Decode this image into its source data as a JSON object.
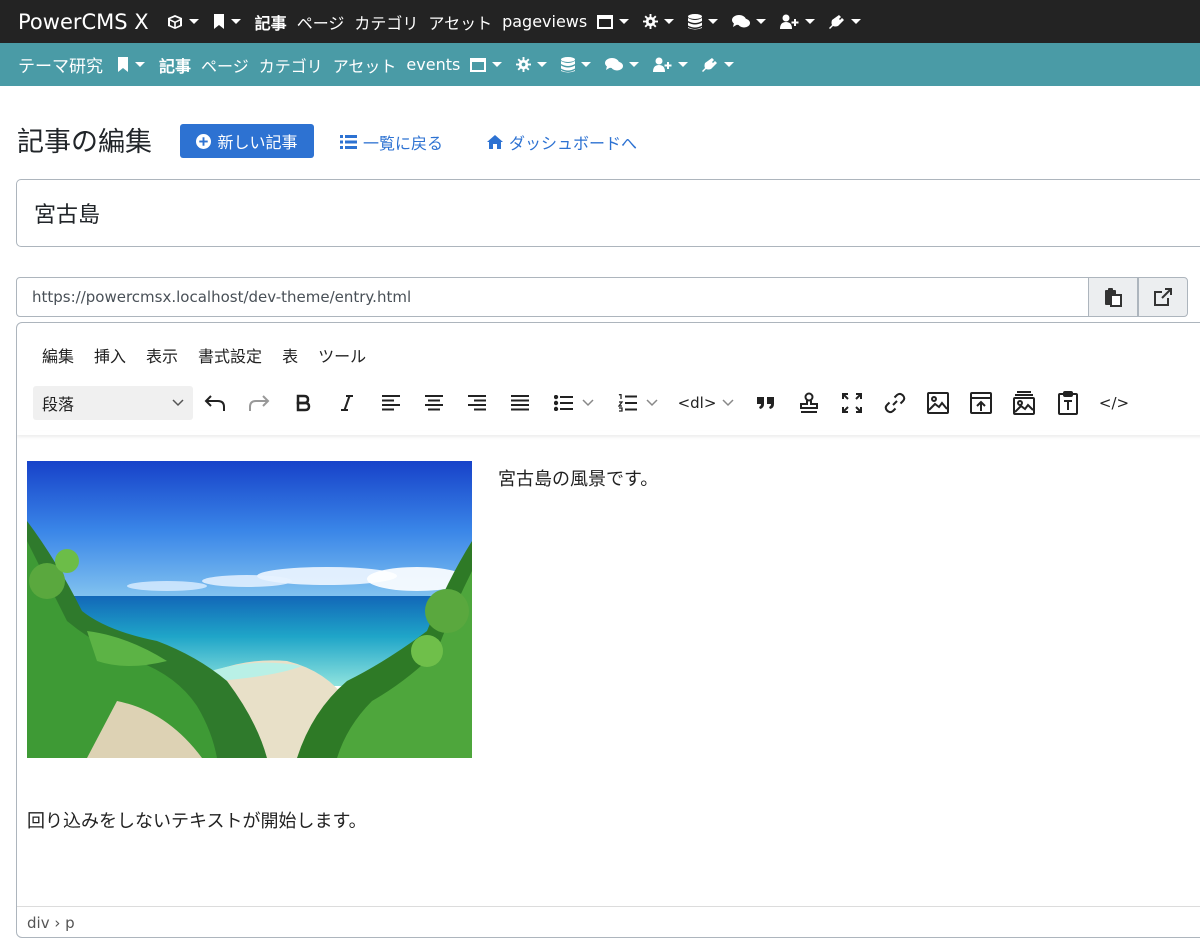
{
  "topnav": {
    "brand": "PowerCMS X",
    "items": [
      "記事",
      "ページ",
      "カテゴリ",
      "アセット",
      "pageviews"
    ]
  },
  "subnav": {
    "brand": "テーマ研究",
    "items": [
      "記事",
      "ページ",
      "カテゴリ",
      "アセット",
      "events"
    ]
  },
  "header": {
    "title": "記事の編集",
    "new_button": "新しい記事",
    "back_link": "一覧に戻る",
    "dashboard_link": "ダッシュボードへ"
  },
  "entry": {
    "title_value": "宮古島",
    "url": "https://powercmsx.localhost/dev-theme/entry.html"
  },
  "editor": {
    "menus": [
      "編集",
      "挿入",
      "表示",
      "書式設定",
      "表",
      "ツール"
    ],
    "format_select": "段落",
    "dl_label": "<dl>",
    "source_label": "</>",
    "paragraph1": "宮古島の風景です。",
    "paragraph2": "回り込みをしないテキストが開始します。",
    "path": "div › p"
  },
  "colors": {
    "topnav_bg": "#232323",
    "subnav_bg": "#4a9ba6",
    "primary": "#2d72d2"
  }
}
